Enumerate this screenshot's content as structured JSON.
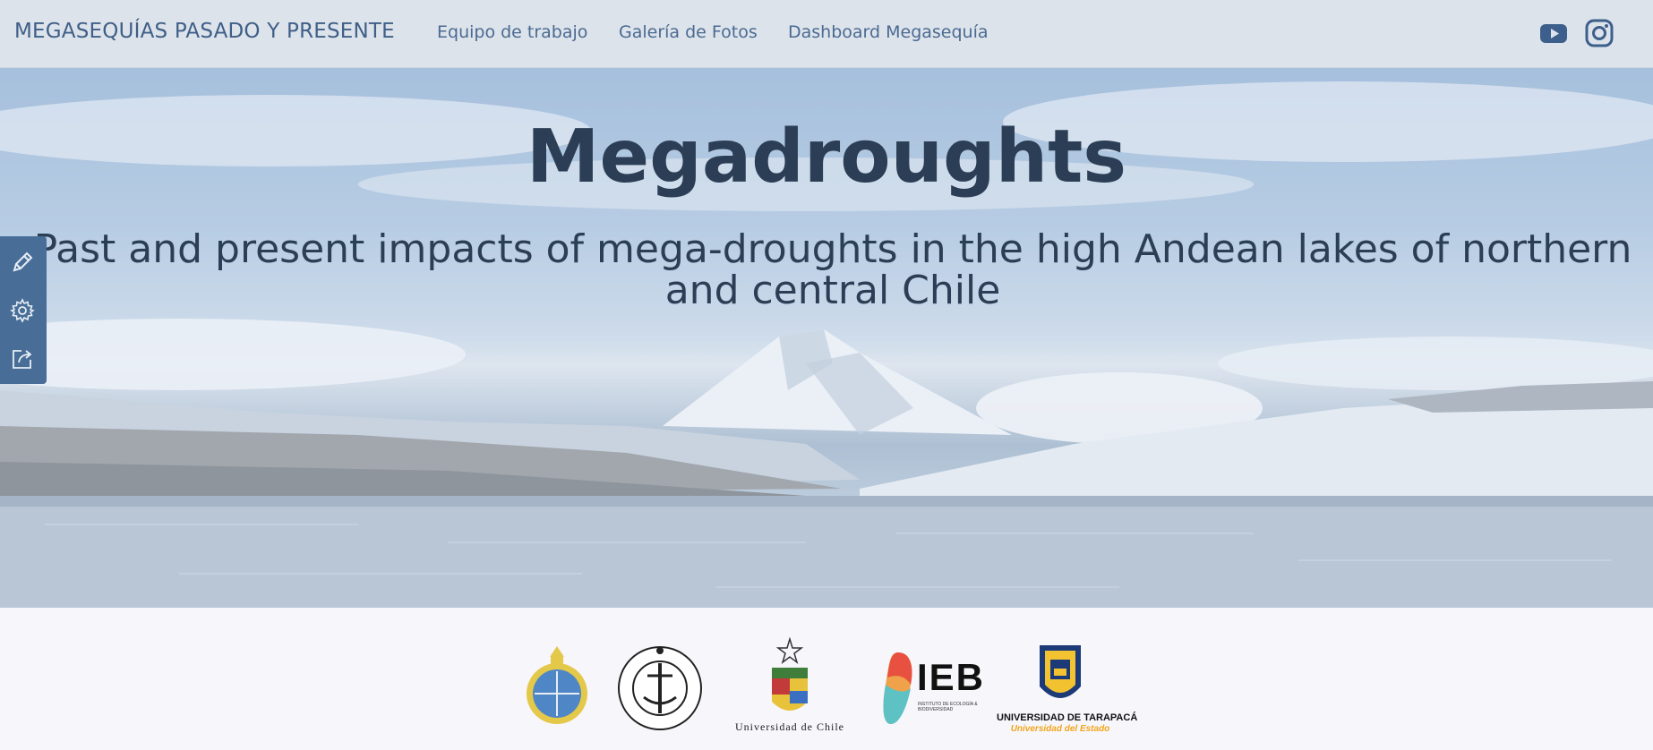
{
  "navbar": {
    "brand": "MEGASEQUÍAS PASADO Y PRESENTE",
    "links": [
      "Equipo de trabajo",
      "Galería de Fotos",
      "Dashboard Megasequía"
    ],
    "social": [
      "youtube-icon",
      "instagram-icon"
    ]
  },
  "hero": {
    "title": "Megadroughts",
    "subtitle": "Past and present impacts of mega-droughts in the high Andean lakes of northern and central Chile"
  },
  "side_toolbar": {
    "icons": [
      "pencil-icon",
      "gear-icon",
      "share-icon"
    ]
  },
  "logos": {
    "universidad_de_chile": "Universidad de Chile",
    "ieb": "IEB",
    "ieb_sub": "INSTITUTO DE ECOLOGÍA & BIODIVERSIDAD",
    "tarapaca": "UNIVERSIDAD DE TARAPACÁ",
    "tarapaca_sub": "Universidad del Estado"
  },
  "colors": {
    "navbar_bg": "#dde3ea",
    "nav_text": "#4a6a92",
    "hero_text": "#2c3e55",
    "toolbar_bg": "#486e98",
    "icon_blue": "#3d5f8c"
  }
}
